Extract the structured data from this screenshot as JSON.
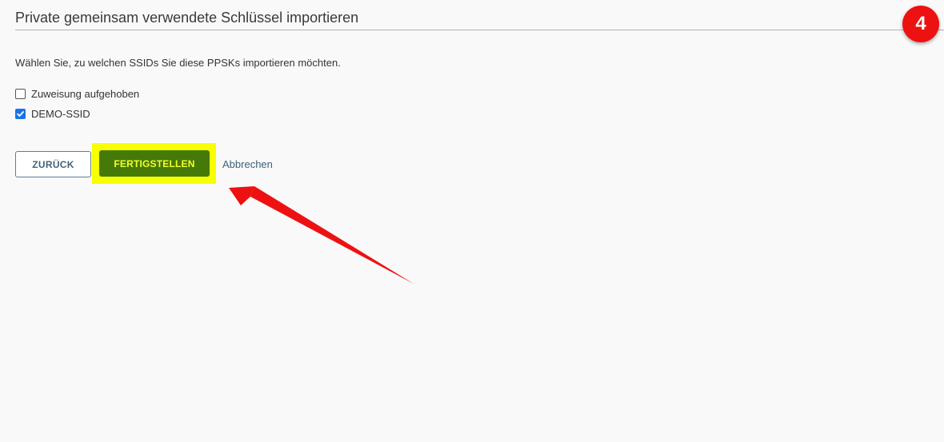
{
  "header": {
    "title": "Private gemeinsam verwendete Schlüssel importieren",
    "step_badge": "4",
    "badge_color": "#ee1111"
  },
  "instruction": "Wählen Sie, zu welchen SSIDs Sie diese PPSKs importieren möchten.",
  "options": [
    {
      "label": "Zuweisung aufgehoben",
      "checked": false
    },
    {
      "label": "DEMO-SSID",
      "checked": true
    }
  ],
  "actions": {
    "back_label": "ZURÜCK",
    "finish_label": "FERTIGSTELLEN",
    "cancel_label": "Abbrechen"
  },
  "annotation": {
    "highlight_color": "#f7ff00",
    "arrow_color": "#ee1111",
    "arrow_icon": "red-pointer-arrow"
  }
}
